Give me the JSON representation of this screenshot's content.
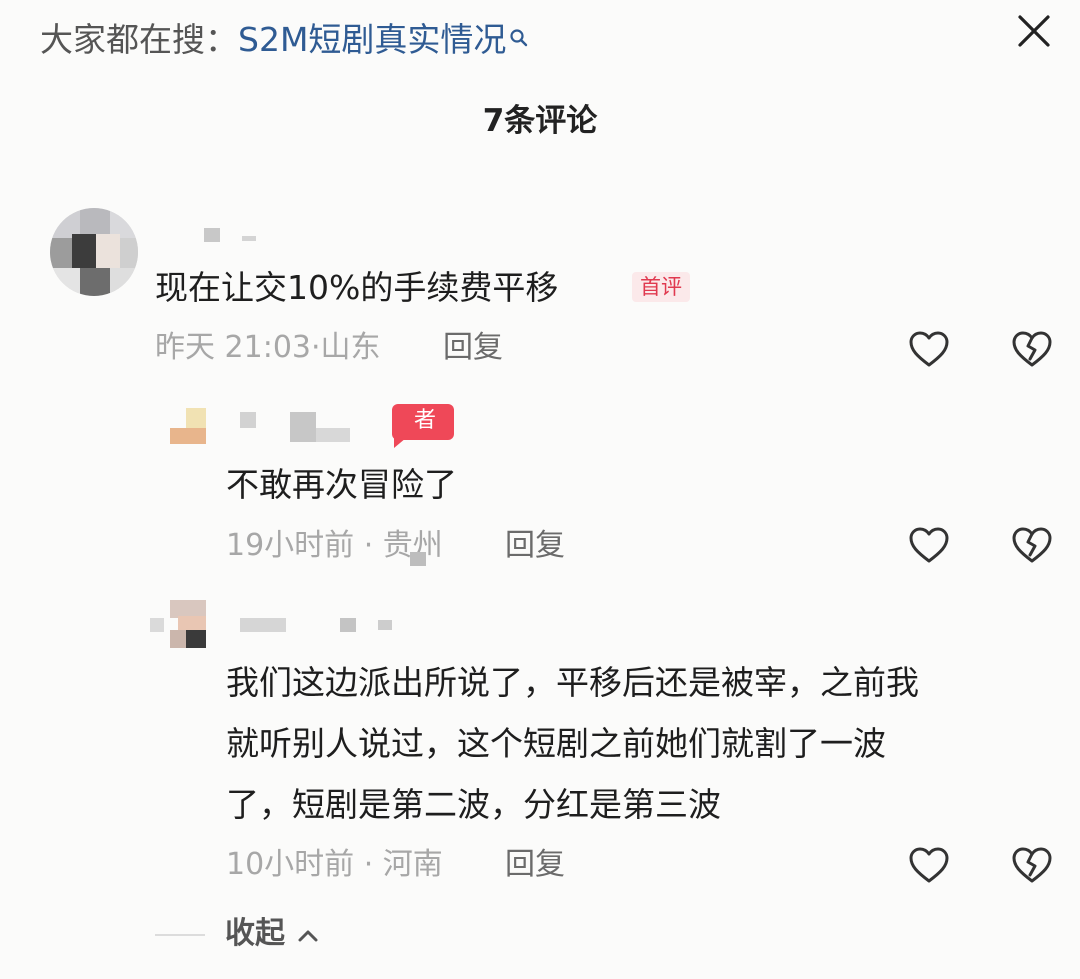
{
  "header": {
    "search_prefix": "大家都在搜：",
    "search_term": "S2M短剧真实情况",
    "search_icon": "search-icon",
    "close_icon": "close-icon",
    "comment_count_title": "7条评论"
  },
  "comments": [
    {
      "text": "现在让交10%的手续费平移",
      "tag": "首评",
      "time": "昨天 21:03",
      "location": "山东",
      "reply_label": "回复"
    }
  ],
  "replies": [
    {
      "badge": "者",
      "text": "不敢再次冒险了",
      "time": "19小时前",
      "location": "贵州",
      "reply_label": "回复"
    },
    {
      "text_lines": [
        "我们这边派出所说了，平移后还是被宰，之前我",
        "就听别人说过，这个短剧之前她们就割了一波",
        "了，短剧是第二波，分红是第三波"
      ],
      "time": "10小时前",
      "location": "河南",
      "reply_label": "回复"
    }
  ],
  "footer": {
    "collapse_label": "收起"
  },
  "icons": [
    "heart-outline-icon",
    "broken-heart-icon",
    "chevron-up-icon"
  ],
  "colors": {
    "link": "#2f5b93",
    "tag_text": "#e0394f",
    "tag_bg": "#fbe9ea",
    "badge_bg": "#ef4858",
    "meta": "#a7a7a7"
  }
}
